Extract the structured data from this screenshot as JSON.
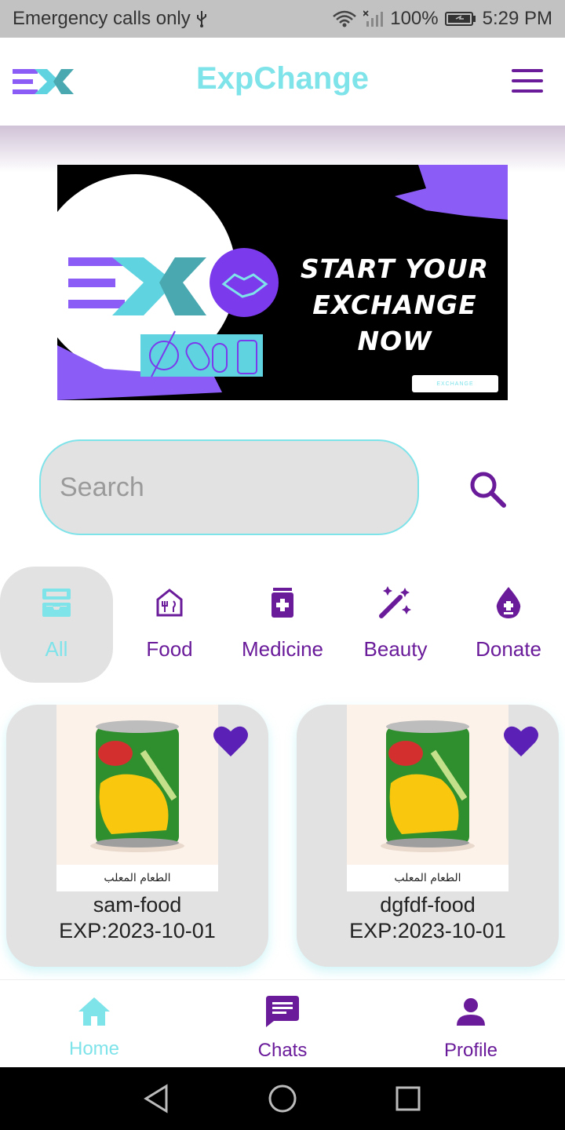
{
  "status_bar": {
    "carrier_text": "Emergency calls only",
    "battery": "100%",
    "time": "5:29 PM"
  },
  "app": {
    "title": "ExpChange",
    "accent": "#7fe3ea",
    "brand_purple": "#6a1b9a"
  },
  "banner": {
    "line1": "START YOUR",
    "line2": "EXCHANGE NOW",
    "tag": "EXCHANGE"
  },
  "search": {
    "placeholder": "Search"
  },
  "categories": [
    {
      "label": "All",
      "icon": "inbox-icon",
      "active": true
    },
    {
      "label": "Food",
      "icon": "food-icon",
      "active": false
    },
    {
      "label": "Medicine",
      "icon": "medicine-icon",
      "active": false
    },
    {
      "label": "Beauty",
      "icon": "magic-wand-icon",
      "active": false
    },
    {
      "label": "Donate",
      "icon": "blood-drop-icon",
      "active": false
    }
  ],
  "products": [
    {
      "name": "sam-food",
      "exp": "EXP:2023-10-01",
      "image_caption": "الطعام المعلب"
    },
    {
      "name": "dgfdf-food",
      "exp": "EXP:2023-10-01",
      "image_caption": "الطعام المعلب"
    }
  ],
  "bottom_nav": [
    {
      "label": "Home",
      "icon": "home-icon",
      "active": true
    },
    {
      "label": "Chats",
      "icon": "chat-icon",
      "active": false
    },
    {
      "label": "Profile",
      "icon": "person-icon",
      "active": false
    }
  ]
}
